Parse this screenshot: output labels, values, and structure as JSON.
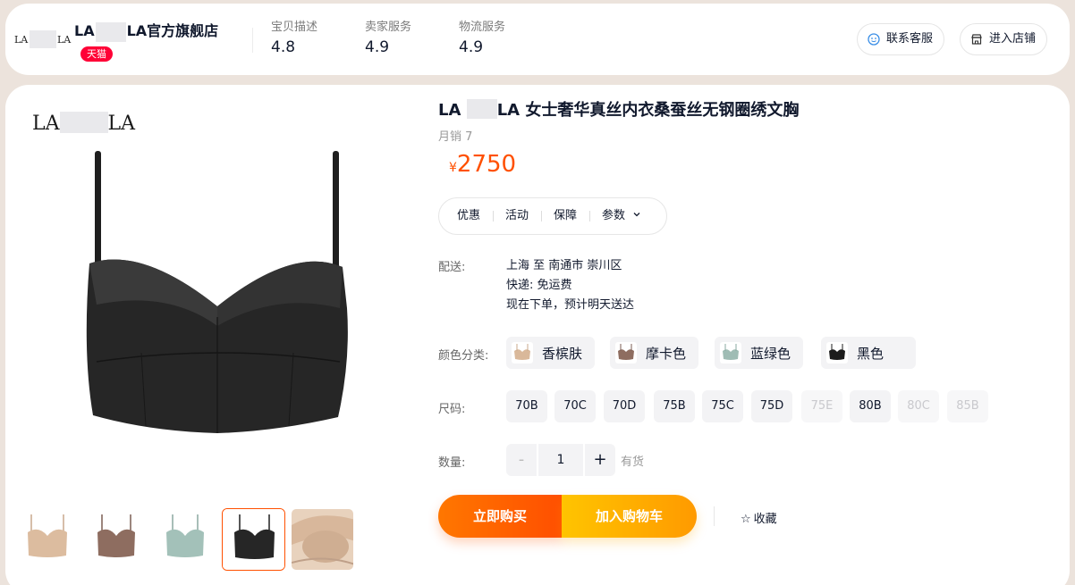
{
  "shop": {
    "logo_text_left": "LA",
    "logo_text_right": "LA",
    "name_prefix": "LA",
    "name_suffix": "LA官方旗舰店",
    "badge": "天猫",
    "scores": [
      {
        "label": "宝贝描述",
        "value": "4.8"
      },
      {
        "label": "卖家服务",
        "value": "4.9"
      },
      {
        "label": "物流服务",
        "value": "4.9"
      }
    ],
    "contact_label": "联系客服",
    "enter_store_label": "进入店铺"
  },
  "product": {
    "image_logo_left": "LA",
    "image_logo_right": "LA",
    "title_prefix": "LA",
    "title_suffix": "LA 女士奢华真丝内衣桑蚕丝无钢圈绣文胸",
    "monthly_sales": "月销 7",
    "currency": "¥",
    "price": "2750",
    "tabs": [
      "优惠",
      "活动",
      "保障",
      "参数"
    ],
    "shipping_label": "配送:",
    "shipping_lines": [
      "上海 至 南通市 崇川区",
      "快递: 免运费",
      "现在下单，预计明天送达"
    ],
    "color_label": "颜色分类:",
    "colors": [
      {
        "name": "香槟肤",
        "hex": "#d9b89a"
      },
      {
        "name": "摩卡色",
        "hex": "#8e6d60"
      },
      {
        "name": "蓝绿色",
        "hex": "#9fbcb4"
      },
      {
        "name": "黑色",
        "hex": "#1c1c1c"
      }
    ],
    "size_label": "尺码:",
    "sizes": [
      {
        "name": "70B",
        "available": true
      },
      {
        "name": "70C",
        "available": true
      },
      {
        "name": "70D",
        "available": true
      },
      {
        "name": "75B",
        "available": true
      },
      {
        "name": "75C",
        "available": true
      },
      {
        "name": "75D",
        "available": true
      },
      {
        "name": "75E",
        "available": false
      },
      {
        "name": "80B",
        "available": true
      },
      {
        "name": "80C",
        "available": false
      },
      {
        "name": "85B",
        "available": false
      }
    ],
    "quantity_label": "数量:",
    "quantity_minus": "-",
    "quantity": "1",
    "quantity_plus": "+",
    "stock": "有货",
    "buy_now_label": "立即购买",
    "add_cart_label": "加入购物车",
    "favorite_label": "收藏",
    "thumbnails": [
      "香槟肤",
      "摩卡色",
      "蓝绿色",
      "黑色",
      "细节"
    ]
  },
  "colors": {
    "accent": "#ff5000",
    "tmall": "#ff0036"
  }
}
